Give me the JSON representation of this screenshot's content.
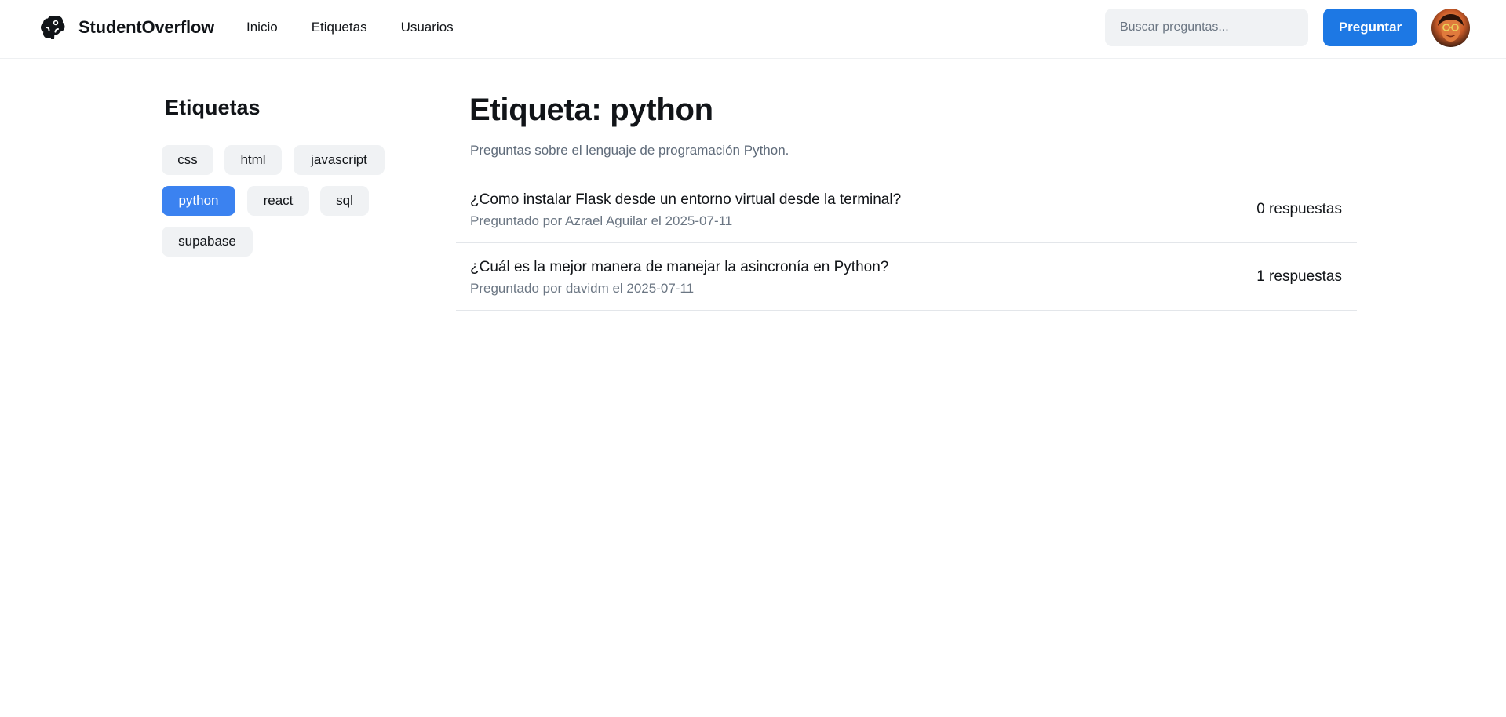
{
  "header": {
    "brand": "StudentOverflow",
    "nav": [
      "Inicio",
      "Etiquetas",
      "Usuarios"
    ],
    "search_placeholder": "Buscar preguntas...",
    "ask_label": "Preguntar",
    "icons": {
      "logo": "brain-logo-icon",
      "avatar": "user-avatar"
    }
  },
  "sidebar": {
    "title": "Etiquetas",
    "tags": [
      {
        "label": "css",
        "active": false
      },
      {
        "label": "html",
        "active": false
      },
      {
        "label": "javascript",
        "active": false
      },
      {
        "label": "python",
        "active": true
      },
      {
        "label": "react",
        "active": false
      },
      {
        "label": "sql",
        "active": false
      },
      {
        "label": "supabase",
        "active": false
      }
    ]
  },
  "main": {
    "title": "Etiqueta: python",
    "description": "Preguntas sobre el lenguaje de programación Python.",
    "questions": [
      {
        "title": "¿Como instalar Flask desde un entorno virtual desde la terminal?",
        "meta": "Preguntado por Azrael Aguilar el 2025-07-11",
        "answers": "0 respuestas"
      },
      {
        "title": "¿Cuál es la mejor manera de manejar la asincronía en Python?",
        "meta": "Preguntado por davidm el 2025-07-11",
        "answers": "1 respuestas"
      }
    ]
  },
  "colors": {
    "accent": "#1d78e4",
    "active_tag": "#3b82f0",
    "tag_bg": "#f0f2f4",
    "muted_text": "#6b7683"
  }
}
